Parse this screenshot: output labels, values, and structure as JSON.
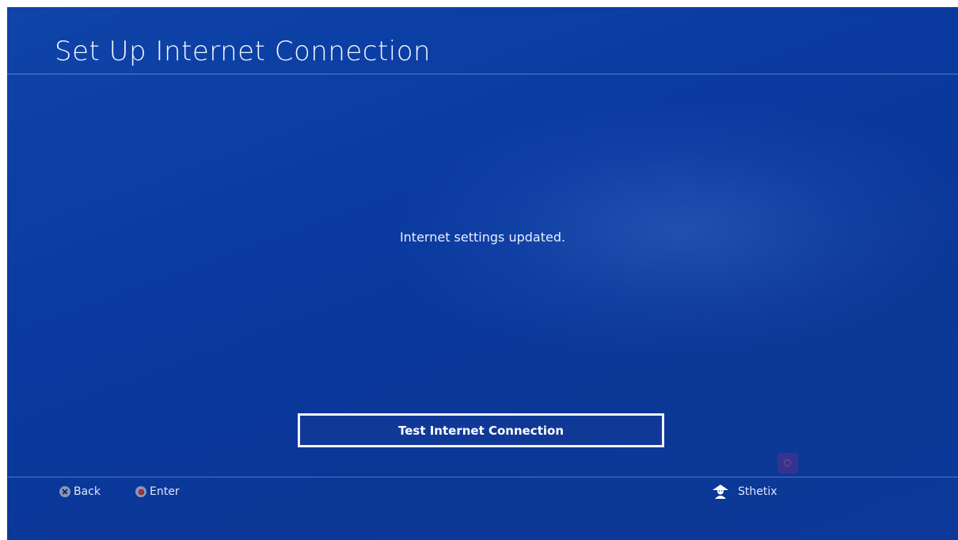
{
  "header": {
    "title": "Set Up Internet Connection"
  },
  "main": {
    "message": "Internet settings updated.",
    "primary_button_label": "Test Internet Connection"
  },
  "footer": {
    "back_label": "Back",
    "enter_label": "Enter",
    "user_name": "Sthetix",
    "icons": [
      "cross-button-icon",
      "circle-button-icon",
      "user-icon"
    ]
  },
  "colors": {
    "background": "#0b3a9e",
    "text": "#ffffff",
    "button_border": "#f2f5ff"
  }
}
